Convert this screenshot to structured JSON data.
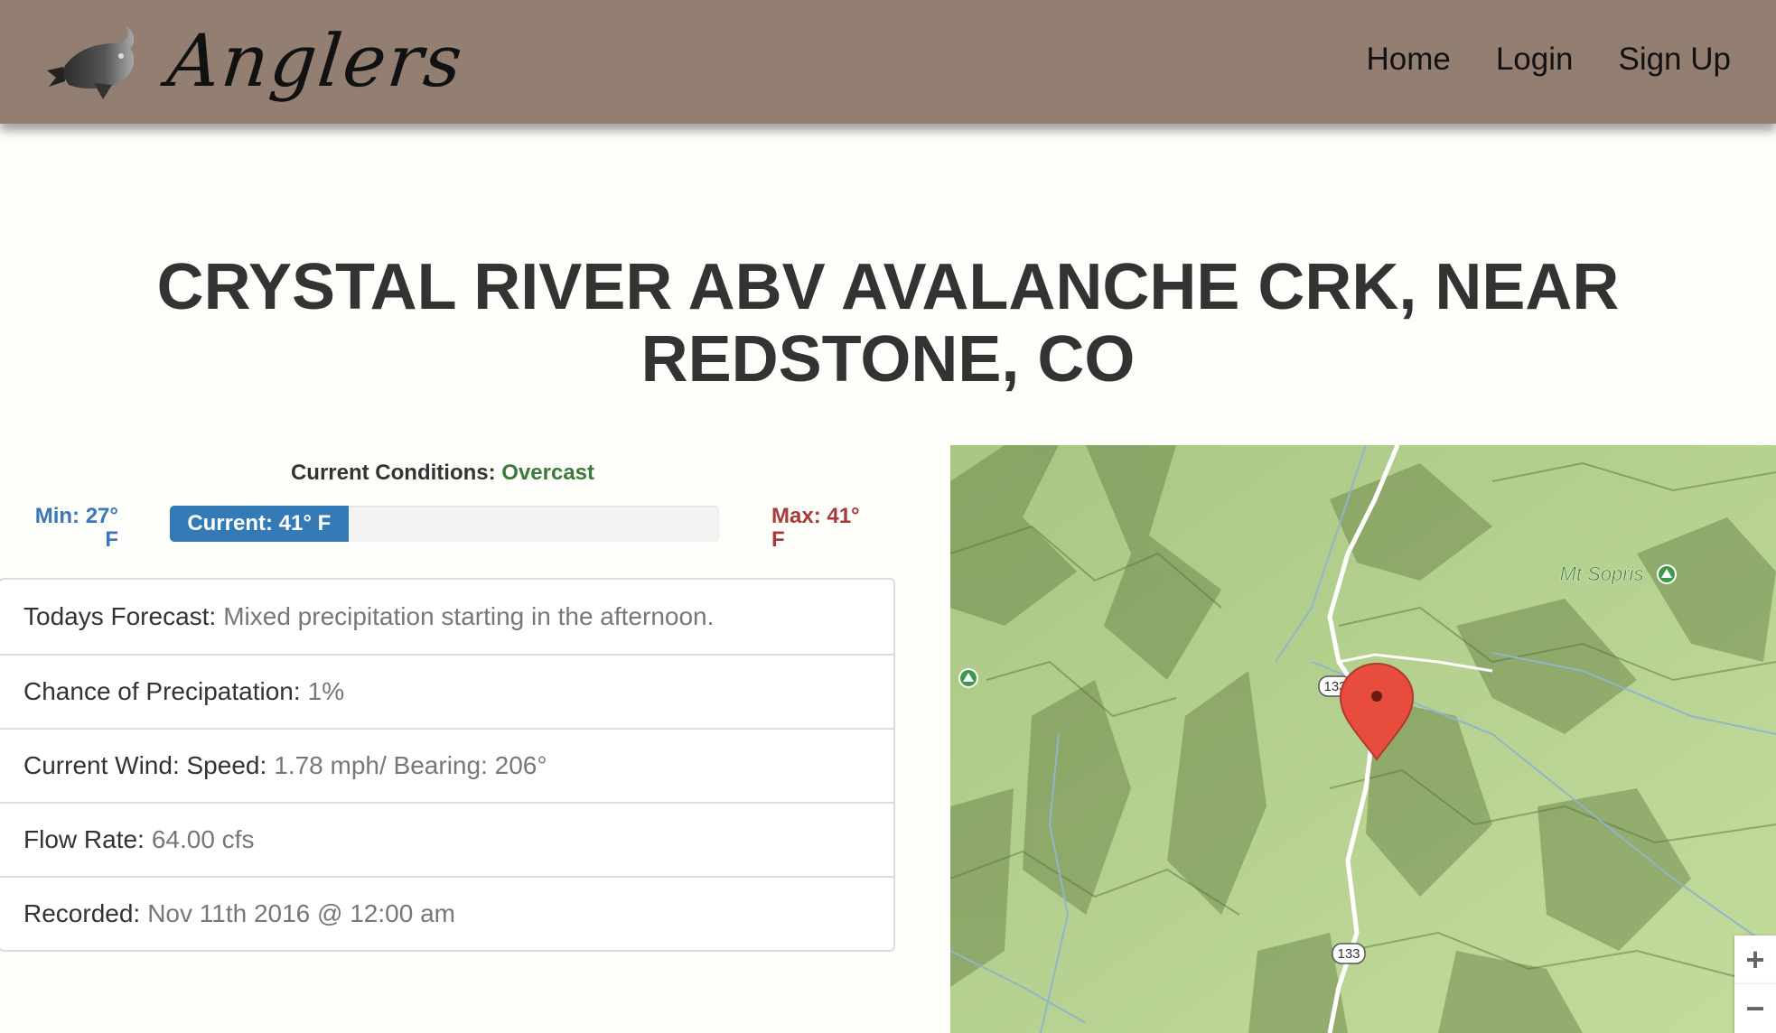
{
  "nav": {
    "brand": "Anglers",
    "links": [
      "Home",
      "Login",
      "Sign Up"
    ]
  },
  "station": {
    "title": "CRYSTAL RIVER ABV AVALANCHE CRK, NEAR REDSTONE, CO"
  },
  "conditions": {
    "label": "Current Conditions:",
    "value": "Overcast",
    "min": "Min: 27° F",
    "current": "Current: 41° F",
    "max": "Max: 41° F",
    "progress_fraction": 0.325
  },
  "details": [
    {
      "label": "Todays Forecast:",
      "value": "Mixed precipitation starting in the afternoon."
    },
    {
      "label": "Chance of Precipatation:",
      "value": "1%"
    },
    {
      "label": "Current Wind: Speed:",
      "value": "1.78 mph/ Bearing: 206°"
    },
    {
      "label": "Flow Rate:",
      "value": "64.00 cfs"
    },
    {
      "label": "Recorded:",
      "value": "Nov 11th 2016 @ 12:00 am"
    }
  ],
  "map": {
    "peak_label": "Mt Sopris",
    "route_label": "133",
    "zoom_in": "+",
    "zoom_out": "−",
    "colors": {
      "terrain": "#b5d18e",
      "ridge": "#7e9a5a",
      "shadow": "#5a7440",
      "road": "#ffffff",
      "river": "#8fb6c9",
      "marker": "#e74c3c",
      "park": "#3e9a4a"
    }
  }
}
